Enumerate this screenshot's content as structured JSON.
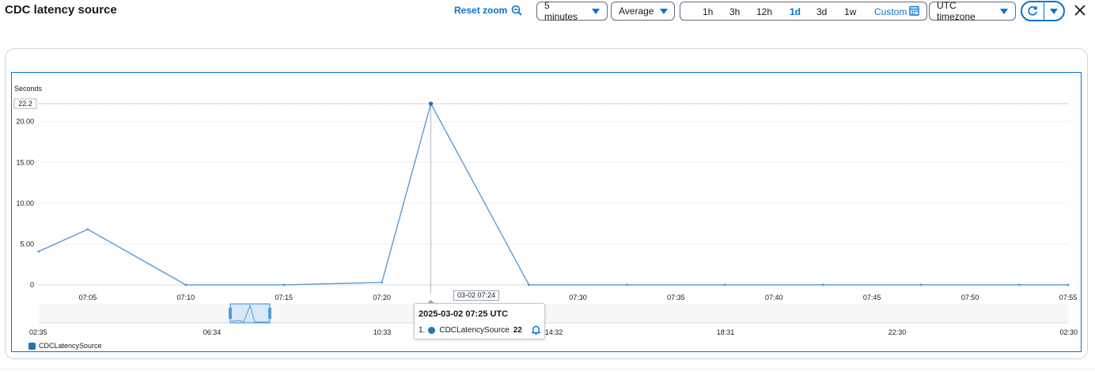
{
  "header": {
    "title": "CDC latency source",
    "reset_zoom": "Reset zoom",
    "period": "5 minutes",
    "statistic": "Average",
    "ranges": [
      "1h",
      "3h",
      "12h",
      "1d",
      "3d",
      "1w"
    ],
    "active_range": "1d",
    "custom": "Custom",
    "timezone": "UTC timezone"
  },
  "tooltip": {
    "title": "2025-03-02 07:25 UTC",
    "index": "1.",
    "series": "CDCLatencySource",
    "value": "22"
  },
  "hover_label": "03-02 07:24",
  "colors": {
    "accent": "#0972d3",
    "series": "#1f77b4",
    "line": "#5b9bd5"
  },
  "chart_data": {
    "type": "line",
    "ylabel": "Seconds",
    "ylim": [
      0,
      22.2
    ],
    "y_ticks": [
      "0",
      "5.00",
      "10.00",
      "15.00",
      "20.00"
    ],
    "y_tick_values": [
      0,
      5,
      10,
      15,
      20
    ],
    "y_max_label": "22.2",
    "x_tick_labels": [
      "07:05",
      "07:10",
      "07:15",
      "07:20",
      "07:30",
      "07:35",
      "07:40",
      "07:45",
      "07:50",
      "07:55"
    ],
    "x_tick_minutes": [
      5,
      10,
      15,
      20,
      30,
      35,
      40,
      45,
      50,
      55
    ],
    "xlim_minutes": [
      2.5,
      55
    ],
    "series": [
      {
        "name": "CDCLatencySource",
        "x_minutes": [
          2.5,
          5,
          10,
          15,
          20,
          22.5,
          27.5,
          32.5,
          37.5,
          42.5,
          47.5,
          52.5,
          55
        ],
        "x": [
          "07:02:30",
          "07:05",
          "07:10",
          "07:15",
          "07:20",
          "07:22:30",
          "07:27:30",
          "07:32:30",
          "07:37:30",
          "07:42:30",
          "07:47:30",
          "07:52:30",
          "07:55"
        ],
        "values": [
          4.1,
          6.8,
          0,
          0,
          0.3,
          22.2,
          0,
          0,
          0,
          0,
          0,
          0,
          0
        ]
      }
    ],
    "legend": [
      "CDCLatencySource"
    ],
    "legend_position": "bottom-left",
    "overview_tick_labels": [
      "02:35",
      "06:34",
      "10:33",
      "14:32",
      "18:31",
      "22:30",
      "02:30"
    ]
  }
}
